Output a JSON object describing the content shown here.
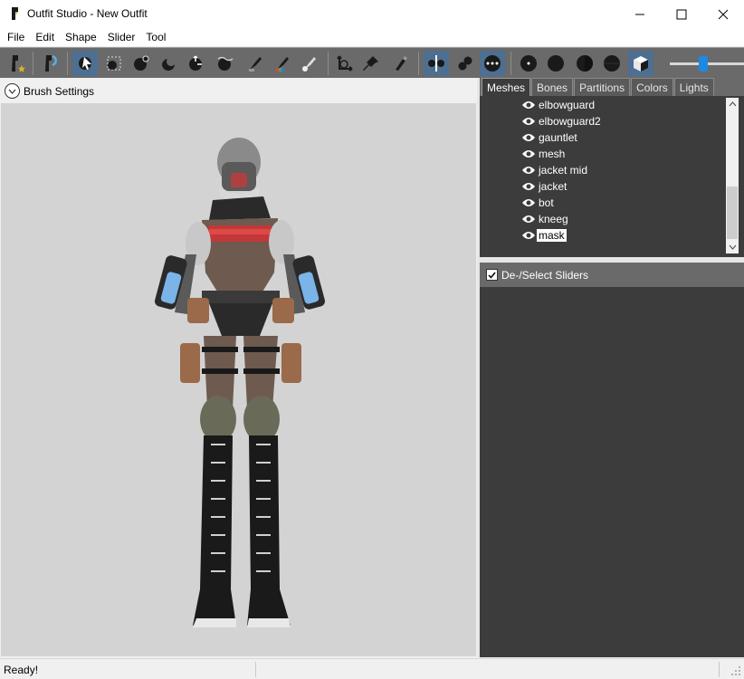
{
  "window": {
    "title": "Outfit Studio - New Outfit",
    "controls": {
      "minimize": "minimize-icon",
      "maximize": "maximize-icon",
      "close": "close-icon"
    }
  },
  "menu": [
    "File",
    "Edit",
    "Shape",
    "Slider",
    "Tool"
  ],
  "toolbar": {
    "buttons": [
      {
        "icon": "new-project-icon",
        "active": false
      },
      {
        "icon": "conform-icon",
        "active": false
      },
      {
        "icon": "select-brush-icon",
        "active": true
      },
      {
        "icon": "mask-brush-icon",
        "active": false
      },
      {
        "icon": "inflate-brush-icon",
        "active": false
      },
      {
        "icon": "deflate-brush-icon",
        "active": false
      },
      {
        "icon": "move-brush-icon",
        "active": false
      },
      {
        "icon": "smooth-brush-icon",
        "active": false
      },
      {
        "icon": "weight-brush-icon",
        "active": false
      },
      {
        "icon": "color-brush-icon",
        "active": false
      },
      {
        "icon": "alpha-brush-icon",
        "active": false
      },
      {
        "icon": "transform-icon",
        "active": false
      },
      {
        "icon": "pivot-icon",
        "active": false
      },
      {
        "icon": "vertex-edit-icon",
        "active": false
      },
      {
        "icon": "x-mirror-icon",
        "active": true
      },
      {
        "icon": "connected-only-icon",
        "active": false
      },
      {
        "icon": "global-brush-icon",
        "active": true
      },
      {
        "icon": "show-vertices-icon",
        "active": false
      },
      {
        "icon": "wireframe-icon",
        "active": false
      },
      {
        "icon": "lighting-icon",
        "active": false
      },
      {
        "icon": "texture-icon",
        "active": false
      },
      {
        "icon": "cube-view-icon",
        "active": true
      }
    ],
    "brush_size_value": 0.45
  },
  "brush_settings": {
    "label": "Brush Settings"
  },
  "tabs": [
    "Meshes",
    "Bones",
    "Partitions",
    "Colors",
    "Lights"
  ],
  "active_tab": "Meshes",
  "meshes": [
    {
      "label": "elbowguard",
      "selected": false
    },
    {
      "label": "elbowguard2",
      "selected": false
    },
    {
      "label": "gauntlet",
      "selected": false
    },
    {
      "label": "mesh",
      "selected": false
    },
    {
      "label": "jacket mid",
      "selected": false
    },
    {
      "label": "jacket",
      "selected": false
    },
    {
      "label": "bot",
      "selected": false
    },
    {
      "label": "kneeg",
      "selected": false
    },
    {
      "label": "mask",
      "selected": true
    }
  ],
  "sliders": {
    "label": "De-/Select Sliders",
    "checked": true
  },
  "status": {
    "text": "Ready!"
  },
  "colors": {
    "toolbar_bg": "#6a6a6a",
    "active_button": "#4d6f91",
    "panel_dark": "#3c3c3c",
    "accent": "#1e88e5",
    "viewport": "#d3d3d3"
  }
}
